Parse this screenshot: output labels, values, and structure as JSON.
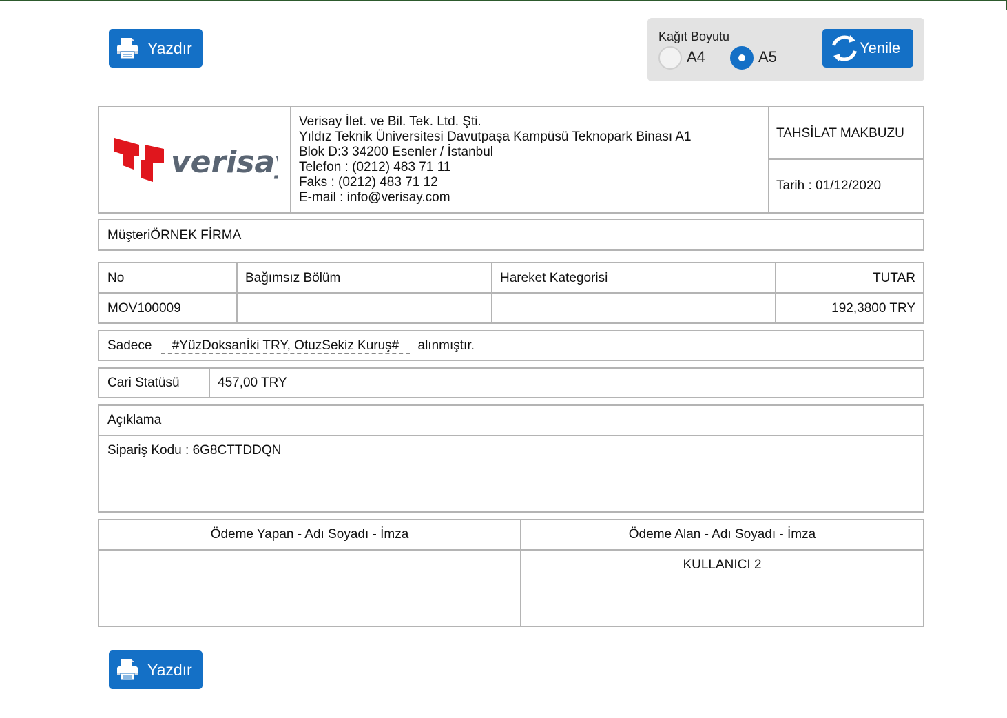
{
  "toolbar": {
    "print_label": "Yazdır",
    "paper_size_title": "Kağıt Boyutu",
    "paper_options": [
      "A4",
      "A5"
    ],
    "paper_selected": "A5",
    "refresh_label": "Yenile"
  },
  "header": {
    "logo_text": "verisay",
    "company_lines": [
      "Verisay İlet. ve Bil. Tek. Ltd. Şti.",
      "Yıldız Teknik Üniversitesi Davutpaşa Kampüsü Teknopark Binası A1",
      "Blok D:3 34200 Esenler / İstanbul",
      "Telefon : (0212) 483 71 11",
      "Faks : (0212) 483 71 12",
      "E-mail : info@verisay.com"
    ],
    "doc_title": "TAHSİLAT MAKBUZU",
    "date_text": "Tarih : 01/12/2020"
  },
  "customer": {
    "label": "Müşteri",
    "value": "ÖRNEK FİRMA"
  },
  "movement_table": {
    "headers": [
      "No",
      "Bağımsız Bölüm",
      "Hareket Kategorisi",
      "TUTAR"
    ],
    "row": [
      "MOV100009",
      "",
      "",
      "192,3800 TRY"
    ]
  },
  "amount_words": {
    "prefix": "Sadece",
    "text": "#YüzDoksanİki TRY, OtuzSekiz Kuruş#",
    "suffix": "alınmıştır."
  },
  "balance": {
    "label": "Cari Statüsü",
    "value": "457,00 TRY"
  },
  "description": {
    "label": "Açıklama",
    "text": "Sipariş Kodu : 6G8CTTDDQN"
  },
  "signatures": {
    "payer_label": "Ödeme Yapan - Adı Soyadı - İmza",
    "payee_label": "Ödeme Alan - Adı Soyadı - İmza",
    "payer_name": "",
    "payee_name": "KULLANICI 2"
  },
  "colors": {
    "button_blue": "#1470c6",
    "border_gray": "#b4b4b4",
    "logo_red": "#e0161d",
    "logo_gray": "#5a6573"
  }
}
